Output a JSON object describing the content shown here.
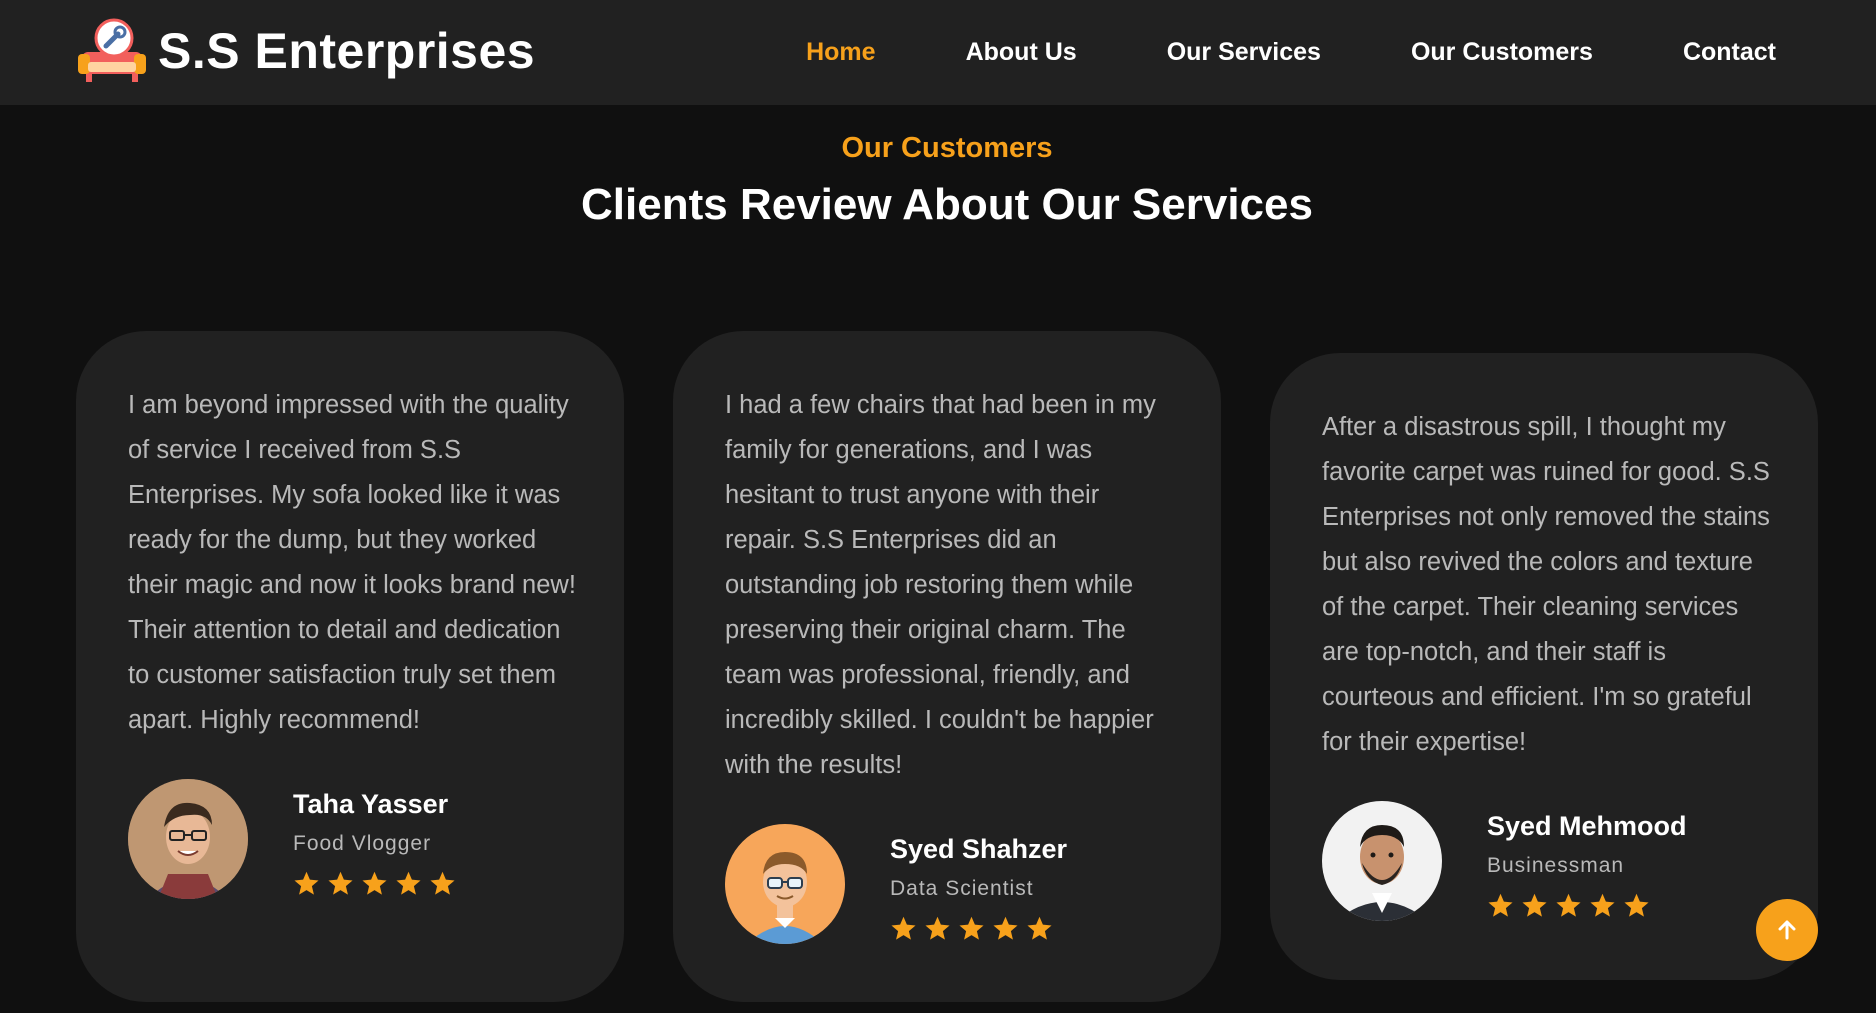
{
  "header": {
    "brand_name": "S.S Enterprises",
    "logo_icon": "sofa-repair-icon",
    "nav": [
      {
        "label": "Home",
        "active": true
      },
      {
        "label": "About Us",
        "active": false
      },
      {
        "label": "Our Services",
        "active": false
      },
      {
        "label": "Our Customers",
        "active": false
      },
      {
        "label": "Contact",
        "active": false
      }
    ]
  },
  "section": {
    "tag": "Our Customers",
    "title": "Clients Review About Our Services"
  },
  "reviews": [
    {
      "text": "I am beyond impressed with the quality of service I received from S.S Enterprises. My sofa looked like it was ready for the dump, but they worked their magic and now it looks brand new! Their attention to detail and dedication to customer satisfaction truly set them apart. Highly recommend!",
      "name": "Taha Yasser",
      "role": "Food Vlogger",
      "rating": 5
    },
    {
      "text": "I had a few chairs that had been in my family for generations, and I was hesitant to trust anyone with their repair. S.S Enterprises did an outstanding job restoring them while preserving their original charm. The team was professional, friendly, and incredibly skilled. I couldn't be happier with the results!",
      "name": "Syed Shahzer",
      "role": "Data Scientist",
      "rating": 5
    },
    {
      "text": "After a disastrous spill, I thought my favorite carpet was ruined for good. S.S Enterprises not only removed the stains but also revived the colors and texture of the carpet. Their cleaning services are top-notch, and their staff is courteous and efficient. I'm so grateful for their expertise!",
      "name": "Syed Mehmood",
      "role": "Businessman",
      "rating": 5
    }
  ],
  "colors": {
    "accent": "#f7a11b",
    "background": "#101010",
    "card": "#212121",
    "navbar": "#212121"
  },
  "scroll_top_icon": "arrow-up-icon"
}
